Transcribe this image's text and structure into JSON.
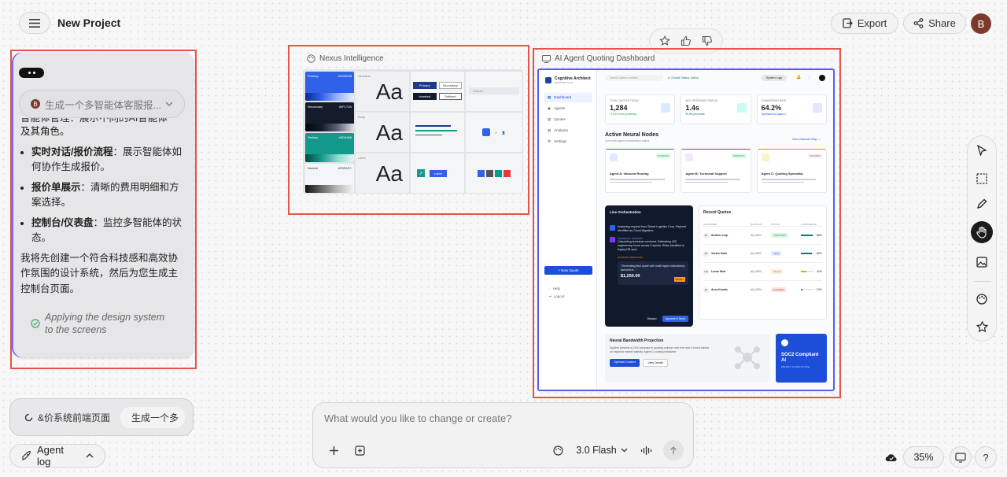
{
  "header": {
    "menu_icon": "hamburger-icon",
    "project_title": "New Project",
    "export_label": "Export",
    "share_label": "Share",
    "avatar_initial": "B"
  },
  "chat": {
    "input_preview": "生成一个多智能体客服报...",
    "avatar_initial": "B",
    "partial_line": "智能体管理：展示不同的AI智能体",
    "partial_line2": "及其角色。",
    "bullets": [
      {
        "bold": "实时对话/报价流程",
        "text": "：展示智能体如何协作生成报价。"
      },
      {
        "bold": "报价单展示",
        "text": "：清晰的费用明细和方案选择。"
      },
      {
        "bold": "控制台/仪表盘",
        "text": "：监控多智能体的状态。"
      }
    ],
    "paragraph": "我将先创建一个符合科技感和高效协作氛围的设计系统，然后为您生成主控制台页面。",
    "status": "Applying the design system to the screens"
  },
  "task_bar": {
    "label": "&价系统前端页面",
    "label2": "生成一个多"
  },
  "agent_log_label": "Agent log",
  "rating": {
    "icons": [
      "star-icon",
      "thumbs-up-icon",
      "thumbs-down-icon"
    ]
  },
  "design_system": {
    "title": "Nexus Intelligence",
    "swatches": [
      {
        "name": "Primary",
        "code": "#1D4ED8",
        "color": "#2f62e6"
      },
      {
        "name": "Secondary",
        "code": "#0F172A",
        "color": "#141c2c"
      },
      {
        "name": "Tertiary",
        "code": "#0D9488",
        "color": "#13988c"
      },
      {
        "name": "Neutral",
        "code": "#F8FAFC",
        "color": "#f4f5f8"
      }
    ],
    "type_labels": [
      "Headline",
      "Body",
      "Label"
    ],
    "type_sample": "Aa",
    "buttons": [
      "Primary",
      "Secondary",
      "Inverted",
      "Outlined"
    ],
    "search_placeholder": "Search",
    "label_chip": "Label"
  },
  "dashboard": {
    "title": "AI Agent Quoting Dashboard",
    "brand": "Cognitive Architect",
    "brand_sub": "NETWORK 02 AI",
    "search_placeholder": "Search system entities...",
    "global_status": "Global Status: Active",
    "system_logs": "System Logs",
    "nav": [
      "Dashboard",
      "Agents",
      "Quotes",
      "Analytics",
      "Settings"
    ],
    "new_quote": "+ New Quote",
    "help": "Help",
    "logout": "Logout",
    "stats": [
      {
        "label": "TOTAL QUOTES TODAY",
        "value": "1,284",
        "sub": "+12.5% from yesterday"
      },
      {
        "label": "AVG. RESPONSE TIME (S)",
        "value": "1.4s",
        "sub": "99.9th percentile"
      },
      {
        "label": "CONVERSION RATE",
        "value": "64.2%",
        "sub": "Optimized by Agent C"
      }
    ],
    "nodes_title": "Active Neural Nodes",
    "nodes_sub": "Live multi-agent orchestration status",
    "view_network": "View Network Map →",
    "agents": [
      {
        "name": "Agent A: Inbound Routing",
        "status": "WORKING",
        "color": "#2f62e6"
      },
      {
        "name": "Agent B: Technical Support",
        "status": "WORKING",
        "color": "#7c3aed"
      },
      {
        "name": "Agent C: Quoting Specialist",
        "status": "STANDBY",
        "color": "#e38b14"
      }
    ],
    "orchestration_title": "Live Orchestration",
    "orch_msg1": "Analyzing request from Global Logistics Corp. Payload identified as Cloud Migration.",
    "orch_label2": "TECHNICAL SUPPORT",
    "orch_msg2": "Calculating technical overhead. Estimating 420 engineering hours across 3 sprints. Risks identified in legacy DB sync.",
    "orch_label3": "QUOTING SPECIALIST",
    "orch_quote": "\"Generating final quote with multi-region redundancy factored in...\"",
    "orch_amount": "$1,250.00",
    "orch_badge": "READY",
    "discard": "Discard",
    "approve": "Approve & Send",
    "recent_title": "Recent Quotes",
    "recent_headers": [
      "CUSTOMER",
      "QUOTE ID",
      "STATUS",
      "CONFIDENCE"
    ],
    "recent_rows": [
      {
        "initials": "SC",
        "customer": "Solaris Corp",
        "id": "#Q-4921",
        "status": "APPROVED",
        "status_color": "#16a34a",
        "conf": 88,
        "conf_label": "88%",
        "bar_color": "#0f766e"
      },
      {
        "initials": "VD",
        "customer": "Vortex Data",
        "id": "#Q-4922",
        "status": "SENT",
        "status_color": "#2563eb",
        "conf": 85,
        "conf_label": "85%",
        "bar_color": "#0f766e"
      },
      {
        "initials": "LM",
        "customer": "Lunar Med",
        "id": "#Q-4923",
        "status": "DRAFT",
        "status_color": "#ca8a04",
        "conf": 42,
        "conf_label": "42%",
        "bar_color": "#f59e0b"
      },
      {
        "initials": "AK",
        "customer": "Aero Kinetic",
        "id": "#Q-4924",
        "status": "FLAGGED",
        "status_color": "#dc2626",
        "conf": 12,
        "conf_label": "12%",
        "bar_color": "#ef4444"
      }
    ],
    "bandwidth_title": "Neural Bandwidth Projection",
    "bandwidth_text": "System predicts a 24% increase in quoting volume over the next 6 hours based on regional market activity. Agent C scaling initialized.",
    "optimize": "Optimize Clusters",
    "view_details": "View Details",
    "soc_title": "SOC2 Compliant AI",
    "soc_sub": "PRIVACY GUARD ACTIVE"
  },
  "prompt": {
    "placeholder": "What would you like to change or create?",
    "model": "3.0 Flash"
  },
  "tools": [
    "cursor-icon",
    "marquee-select-icon",
    "pencil-icon",
    "hand-icon",
    "image-icon",
    "palette-icon",
    "sparkle-star-icon"
  ],
  "zoom": "35%"
}
